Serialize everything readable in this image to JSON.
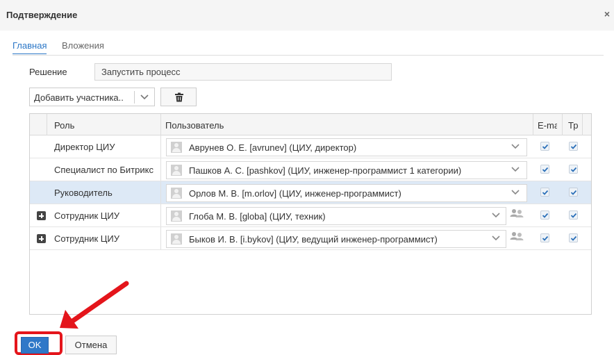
{
  "dialog": {
    "title": "Подтверждение",
    "close_glyph": "×"
  },
  "tabs": [
    {
      "label": "Главная",
      "active": true
    },
    {
      "label": "Вложения",
      "active": false
    }
  ],
  "decision": {
    "label": "Решение",
    "value": "Запустить процесс"
  },
  "toolbar": {
    "add_participant_label": "Добавить участника..",
    "delete_icon": "trash-icon"
  },
  "grid": {
    "columns": {
      "role": "Роль",
      "user": "Пользователь",
      "email": "E-mail",
      "tp": "Тр"
    },
    "rows": [
      {
        "role": "Директор ЦИУ",
        "user": "Аврунев О. Е. [avrunev] (ЦИУ, директор)",
        "expandable": false,
        "group": false,
        "email": true,
        "tp": true,
        "selected": false
      },
      {
        "role": "Специалист по Битрикс",
        "user": "Пашков А. С. [pashkov] (ЦИУ, инженер-программист 1 категории)",
        "expandable": false,
        "group": false,
        "email": true,
        "tp": true,
        "selected": false
      },
      {
        "role": "Руководитель",
        "user": "Орлов М. В. [m.orlov] (ЦИУ, инженер-программист)",
        "expandable": false,
        "group": false,
        "email": true,
        "tp": true,
        "selected": true
      },
      {
        "role": "Сотрудник ЦИУ",
        "user": "Глоба М. В. [globa] (ЦИУ, техник)",
        "expandable": true,
        "group": true,
        "email": true,
        "tp": true,
        "selected": false
      },
      {
        "role": "Сотрудник ЦИУ",
        "user": "Быков И. В. [i.bykov] (ЦИУ, ведущий инженер-программист)",
        "expandable": true,
        "group": true,
        "email": true,
        "tp": true,
        "selected": false
      }
    ]
  },
  "footer": {
    "ok_label": "OK",
    "cancel_label": "Отмена"
  },
  "colors": {
    "accent": "#2f78c8",
    "selected_row": "#dde9f6",
    "annotation_red": "#e4151b"
  }
}
